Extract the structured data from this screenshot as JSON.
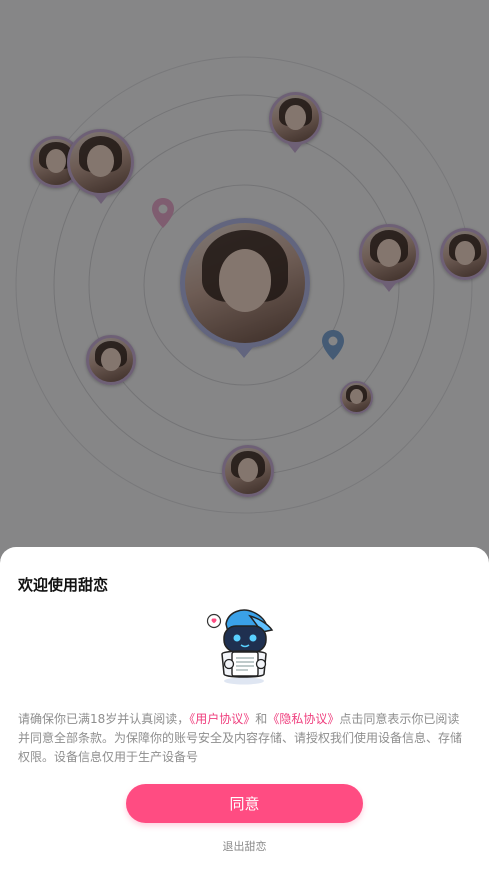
{
  "dialog": {
    "title": "欢迎使用甜恋",
    "text_before": "请确保你已满18岁并认真阅读，",
    "user_agreement_link": "《用户协议》",
    "text_and": "和",
    "privacy_link": "《隐私协议》",
    "text_after": "点击同意表示你已阅读并同意全部条款。为保障你的账号安全及内容存储、请授权我们使用设备信息、存储权限。设备信息仅用于生产设备号",
    "agree_button": "同意",
    "exit_link": "退出甜恋"
  },
  "icons": {
    "location_pin": "location-pin-icon",
    "mascot": "robot-mascot-icon"
  },
  "colors": {
    "accent": "#ff4c82",
    "link": "#ef3f7e",
    "pin_pink": "#e8a9cc",
    "pin_blue": "#7fa7d6",
    "avatar_ring": "#c9b0d8"
  }
}
